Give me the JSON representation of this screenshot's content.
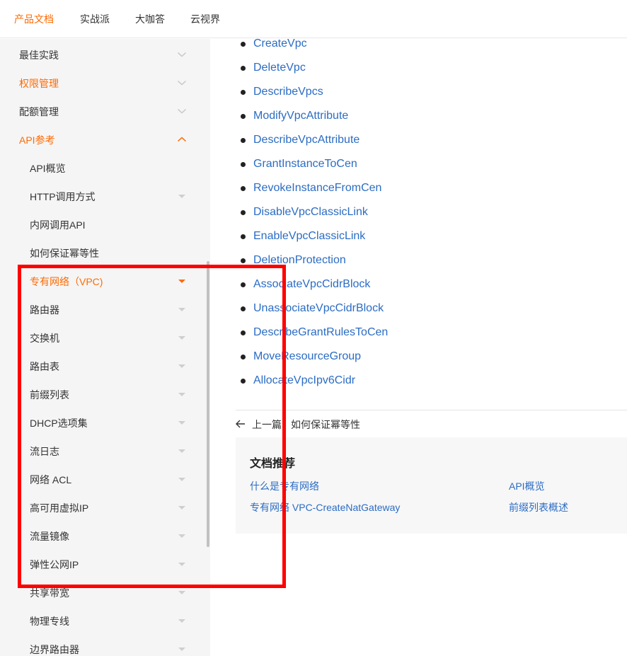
{
  "colors": {
    "accent": "#ff6a00",
    "link": "#2b6cc4",
    "highlight": "#ff0000",
    "sidebar_bg": "#f5f5f6"
  },
  "topnav": {
    "tabs": [
      {
        "label": "产品文档",
        "active": true
      },
      {
        "label": "实战派"
      },
      {
        "label": "大咖答"
      },
      {
        "label": "云视界"
      }
    ]
  },
  "sidebar": {
    "items": [
      {
        "label": "最佳实践",
        "arrow": "chevron-down-icon"
      },
      {
        "label": "权限管理",
        "arrow": "chevron-down-icon",
        "active": true
      },
      {
        "label": "配额管理",
        "arrow": "chevron-down-icon"
      },
      {
        "label": "API参考",
        "arrow": "chevron-up-icon",
        "active": true
      },
      {
        "label": "API概览"
      },
      {
        "label": "HTTP调用方式",
        "arrow": "caret-down-icon"
      },
      {
        "label": "内网调用API"
      },
      {
        "label": "如何保证幂等性"
      },
      {
        "label": "专有网络（VPC)",
        "arrow": "caret-down-icon",
        "active": true
      },
      {
        "label": "路由器",
        "arrow": "caret-down-icon"
      },
      {
        "label": "交换机",
        "arrow": "caret-down-icon"
      },
      {
        "label": "路由表",
        "arrow": "caret-down-icon"
      },
      {
        "label": "前缀列表",
        "arrow": "caret-down-icon"
      },
      {
        "label": "DHCP选项集",
        "arrow": "caret-down-icon"
      },
      {
        "label": "流日志",
        "arrow": "caret-down-icon"
      },
      {
        "label": "网络 ACL",
        "arrow": "caret-down-icon"
      },
      {
        "label": "高可用虚拟IP",
        "arrow": "caret-down-icon"
      },
      {
        "label": "流量镜像",
        "arrow": "caret-down-icon"
      },
      {
        "label": "弹性公网IP",
        "arrow": "caret-down-icon"
      },
      {
        "label": "共享带宽",
        "arrow": "caret-down-icon"
      },
      {
        "label": "物理专线",
        "arrow": "caret-down-icon"
      },
      {
        "label": "边界路由器",
        "arrow": "caret-down-icon"
      }
    ]
  },
  "main": {
    "api_links": [
      "CreateVpc",
      "DeleteVpc",
      "DescribeVpcs",
      "ModifyVpcAttribute",
      "DescribeVpcAttribute",
      "GrantInstanceToCen",
      "RevokeInstanceFromCen",
      "DisableVpcClassicLink",
      "EnableVpcClassicLink",
      "DeletionProtection",
      "AssociateVpcCidrBlock",
      "UnassociateVpcCidrBlock",
      "DescribeGrantRulesToCen",
      "MoveResourceGroup",
      "AllocateVpcIpv6Cidr"
    ],
    "prev": {
      "prefix": "上一篇：",
      "title": "如何保证幂等性"
    },
    "recommend": {
      "title": "文档推荐",
      "links": [
        "什么是专有网络",
        "API概览",
        "专有网络 VPC-CreateNatGateway",
        "前缀列表概述"
      ]
    }
  }
}
